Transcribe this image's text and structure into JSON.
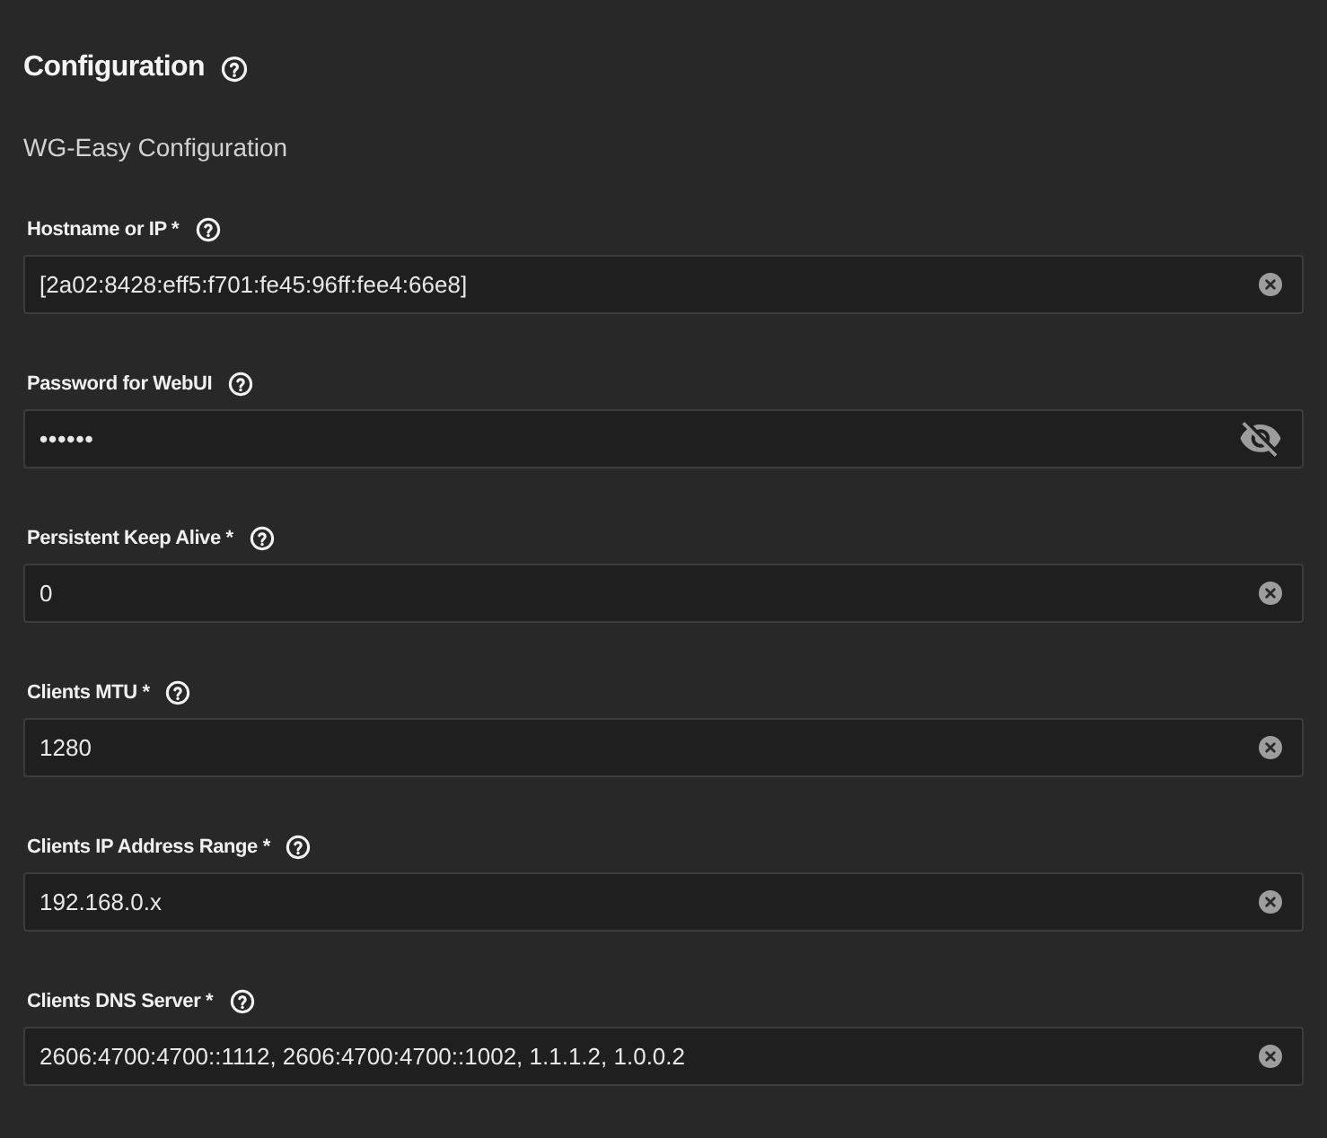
{
  "section": {
    "title": "Configuration",
    "subtitle": "WG-Easy Configuration"
  },
  "fields": [
    {
      "label": "Hostname or IP *",
      "kind": "text",
      "value": "[2a02:8428:eff5:f701:fe45:96ff:fee4:66e8]"
    },
    {
      "label": "Password for WebUI",
      "kind": "password",
      "value": "••••••"
    },
    {
      "label": "Persistent Keep Alive *",
      "kind": "text",
      "value": "0"
    },
    {
      "label": "Clients MTU *",
      "kind": "text",
      "value": "1280"
    },
    {
      "label": "Clients IP Address Range *",
      "kind": "text",
      "value": "192.168.0.x"
    },
    {
      "label": "Clients DNS Server *",
      "kind": "text",
      "value": "2606:4700:4700::1112, 2606:4700:4700::1002, 1.1.1.2, 1.0.0.2"
    }
  ]
}
